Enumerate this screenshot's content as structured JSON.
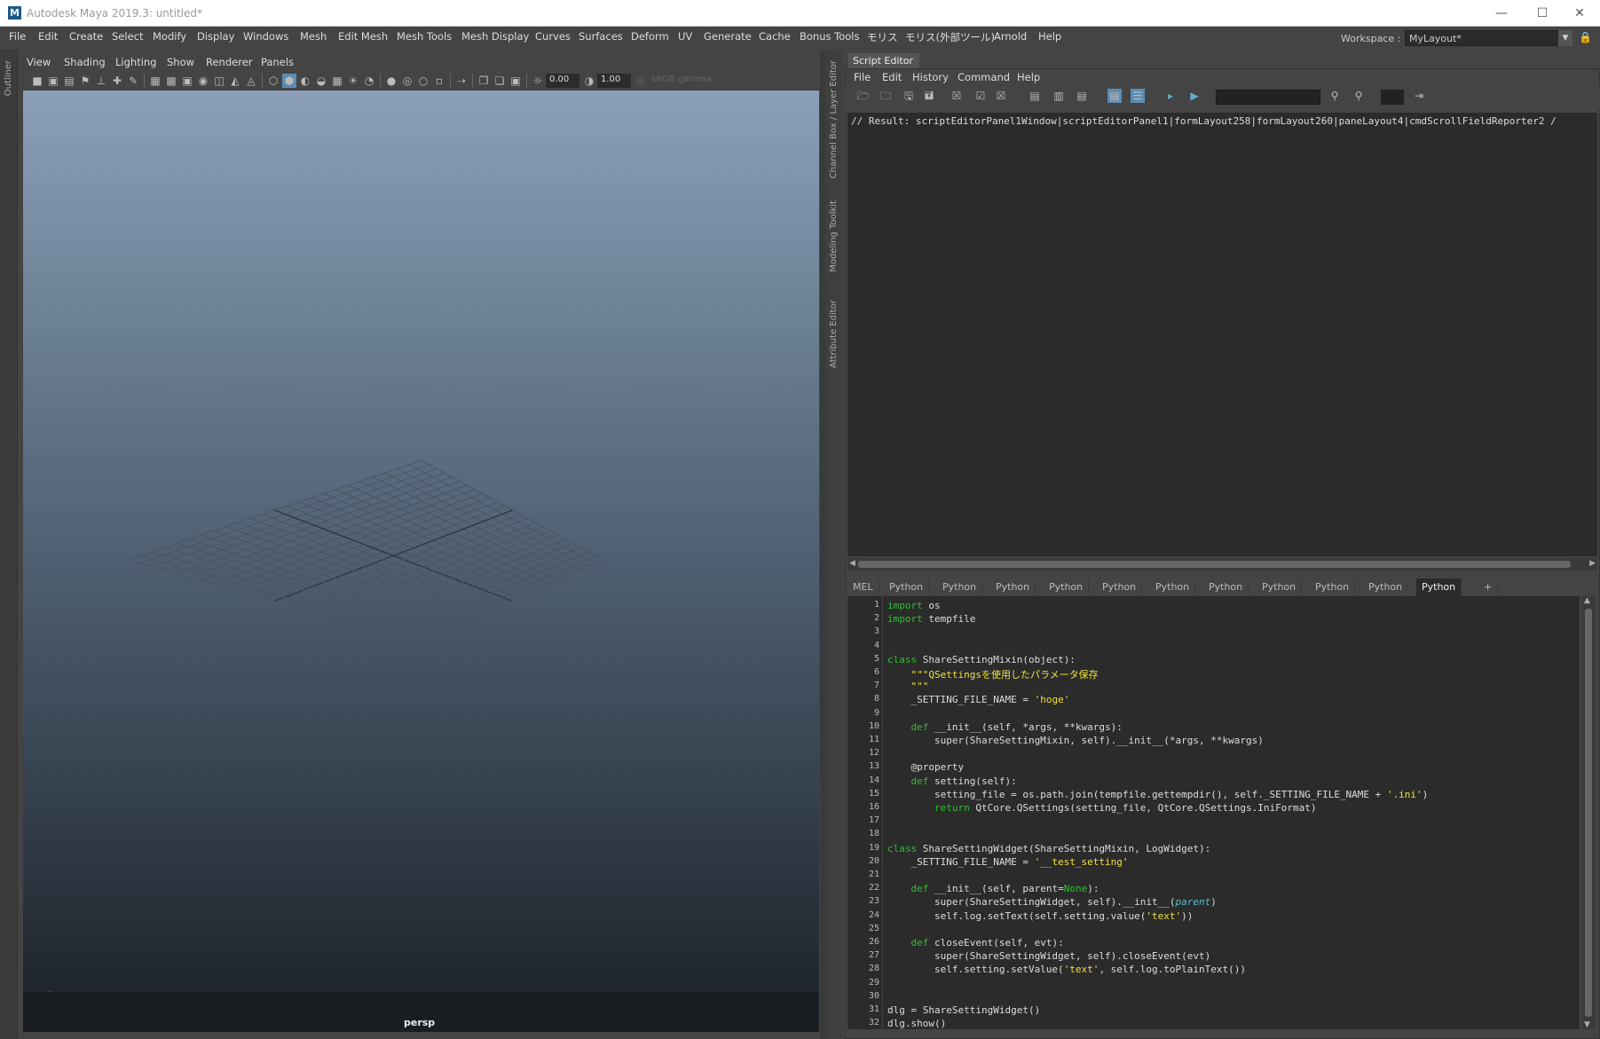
{
  "window": {
    "title": "Autodesk Maya 2019.3: untitled*",
    "logo": "M"
  },
  "menu": [
    "File",
    "Edit",
    "Create",
    "Select",
    "Modify",
    "Display",
    "Windows",
    "Mesh",
    "Edit Mesh",
    "Mesh Tools",
    "Mesh Display",
    "Curves",
    "Surfaces",
    "Deform",
    "UV",
    "Generate",
    "Cache",
    "Bonus Tools",
    "モリス",
    "モリス(外部ツール)",
    "Arnold",
    "Help"
  ],
  "workspace": {
    "label": "Workspace :",
    "value": "MyLayout*"
  },
  "left_strip": {
    "label": "Outliner"
  },
  "viewport": {
    "menu": [
      "View",
      "Shading",
      "Lighting",
      "Show",
      "Renderer",
      "Panels"
    ],
    "field_a": "0.00",
    "field_b": "1.00",
    "gamma": "sRGB gamma",
    "camera": "persp"
  },
  "right_strip": {
    "labels": [
      "Channel Box / Layer Editor",
      "Modeling Toolkit",
      "Attribute Editor"
    ]
  },
  "script_editor": {
    "tab": "Script Editor",
    "menu": [
      "File",
      "Edit",
      "History",
      "Command",
      "Help"
    ],
    "output": "// Result: scriptEditorPanel1Window|scriptEditorPanel1|formLayout258|formLayout260|paneLayout4|cmdScrollFieldReporter2 /",
    "tabs": [
      "MEL",
      "Python",
      "Python",
      "Python",
      "Python",
      "Python",
      "Python",
      "Python",
      "Python",
      "Python",
      "Python",
      "Python",
      "+"
    ],
    "active_tab_index": 11
  },
  "code_lines": [
    [
      [
        "kw",
        "import"
      ],
      [
        "n",
        " os"
      ]
    ],
    [
      [
        "kw",
        "import"
      ],
      [
        "n",
        " tempfile"
      ]
    ],
    [],
    [],
    [
      [
        "kw",
        "class"
      ],
      [
        "n",
        " ShareSettingMixin(object):"
      ]
    ],
    [
      [
        "n",
        "    "
      ],
      [
        "st",
        "\"\"\"QSettingsを使用したパラメータ保存"
      ]
    ],
    [
      [
        "n",
        "    "
      ],
      [
        "st",
        "\"\"\""
      ]
    ],
    [
      [
        "n",
        "    _SETTING_FILE_NAME = "
      ],
      [
        "st",
        "'hoge'"
      ]
    ],
    [],
    [
      [
        "n",
        "    "
      ],
      [
        "kw",
        "def"
      ],
      [
        "n",
        " __init__(self, *args, **kwargs):"
      ]
    ],
    [
      [
        "n",
        "        super(ShareSettingMixin, self).__init__(*args, **kwargs)"
      ]
    ],
    [],
    [
      [
        "n",
        "    @property"
      ]
    ],
    [
      [
        "n",
        "    "
      ],
      [
        "kw",
        "def"
      ],
      [
        "n",
        " setting(self):"
      ]
    ],
    [
      [
        "n",
        "        setting_file = os.path.join(tempfile.gettempdir(), self._SETTING_FILE_NAME + "
      ],
      [
        "st",
        "'.ini'"
      ],
      [
        "n",
        ")"
      ]
    ],
    [
      [
        "n",
        "        "
      ],
      [
        "kw",
        "return"
      ],
      [
        "n",
        " QtCore.QSettings(setting_file, QtCore.QSettings.IniFormat)"
      ]
    ],
    [],
    [],
    [
      [
        "kw",
        "class"
      ],
      [
        "n",
        " ShareSettingWidget(ShareSettingMixin, LogWidget):"
      ]
    ],
    [
      [
        "n",
        "    _SETTING_FILE_NAME = "
      ],
      [
        "st",
        "'__test_setting'"
      ]
    ],
    [],
    [
      [
        "n",
        "    "
      ],
      [
        "kw",
        "def"
      ],
      [
        "n",
        " __init__(self, parent="
      ],
      [
        "kw",
        "None"
      ],
      [
        "n",
        "):"
      ]
    ],
    [
      [
        "n",
        "        super(ShareSettingWidget, self).__init__("
      ],
      [
        "it",
        "parent"
      ],
      [
        "n",
        ")"
      ]
    ],
    [
      [
        "n",
        "        self.log.setText(self.setting.value("
      ],
      [
        "st",
        "'text'"
      ],
      [
        "n",
        "))"
      ]
    ],
    [],
    [
      [
        "n",
        "    "
      ],
      [
        "kw",
        "def"
      ],
      [
        "n",
        " closeEvent(self, evt):"
      ]
    ],
    [
      [
        "n",
        "        super(ShareSettingWidget, self).closeEvent(evt)"
      ]
    ],
    [
      [
        "n",
        "        self.setting.setValue("
      ],
      [
        "st",
        "'text'"
      ],
      [
        "n",
        ", self.log.toPlainText())"
      ]
    ],
    [],
    [],
    [
      [
        "n",
        "dlg = ShareSettingWidget()"
      ]
    ],
    [
      [
        "n",
        "dlg.show()"
      ]
    ]
  ]
}
